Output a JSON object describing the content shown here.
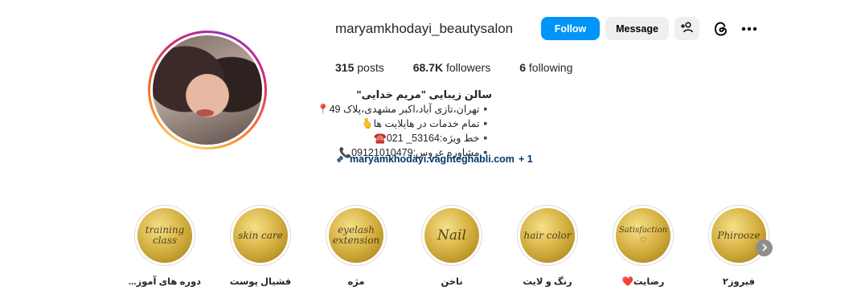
{
  "profile": {
    "username": "maryamkhodayi_beautysalon",
    "follow_label": "Follow",
    "message_label": "Message",
    "suggest_icon": "person-add-icon",
    "threads_icon": "threads-icon",
    "more_icon": "more-horizontal-icon"
  },
  "stats": {
    "posts_count": "315",
    "posts_label": "posts",
    "followers_count": "68.7K",
    "followers_label": "followers",
    "following_count": "6",
    "following_label": "following"
  },
  "bio": {
    "name": "سالن زیبایی \"مریم خدایی\"",
    "lines": [
      "▪️تهران،تازی آباد،اکبر مشهدی،پلاک 49📍",
      "▪️تمام خدمات در هایلایت ها🫰",
      "▪️خط ویژه:53164_ 021☎️",
      "▪️مشاوره عروس:09121010479📞"
    ],
    "link_text": "maryamkhodayi.vaghteghabli.com",
    "link_extra": "+ 1",
    "link_icon": "link-icon"
  },
  "highlights": [
    {
      "script": "training class",
      "label": "دوره های آموز..."
    },
    {
      "script": "skin care",
      "label": "فشیال پوست"
    },
    {
      "script": "eyelash extension",
      "label": "مژه"
    },
    {
      "script": "Nail",
      "label": "ناخن"
    },
    {
      "script": "hair color",
      "label": "رنگ و لایت"
    },
    {
      "script": "Satisfaction ♡",
      "label": "رضایت❤️"
    },
    {
      "script": "Phirooze",
      "label": "فیروز۲"
    }
  ],
  "colors": {
    "accent": "#0095f6",
    "button_gray": "#efefef",
    "link": "#00376b",
    "highlight_gold": "#d8b447"
  }
}
